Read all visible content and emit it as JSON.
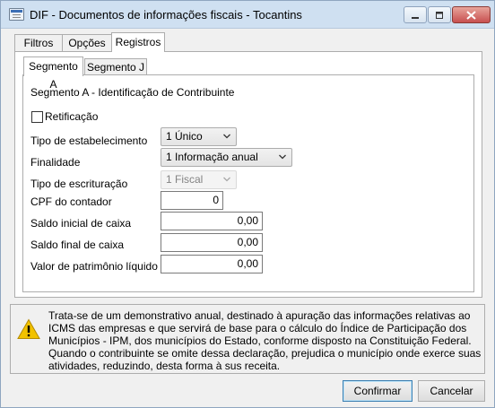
{
  "window": {
    "title": "DIF - Documentos de informações fiscais - Tocantins"
  },
  "tabs": [
    {
      "label": "Filtros",
      "active": false
    },
    {
      "label": "Opções",
      "active": false
    },
    {
      "label": "Registros",
      "active": true
    }
  ],
  "subtabs": [
    {
      "label": "Segmento A",
      "active": true
    },
    {
      "label": "Segmento J",
      "active": false
    }
  ],
  "form": {
    "section_title": "Segmento A - Identificação de Contribuinte",
    "retificacao_label": "Retificação",
    "retificacao_checked": false,
    "tipo_estabelecimento_label": "Tipo de estabelecimento",
    "tipo_estabelecimento_value": "1 Único",
    "finalidade_label": "Finalidade",
    "finalidade_value": "1 Informação anual",
    "tipo_escrituracao_label": "Tipo de escrituração",
    "tipo_escrituracao_value": "1 Fiscal",
    "cpf_contador_label": "CPF do contador",
    "cpf_contador_value": "0",
    "saldo_inicial_label": "Saldo inicial de caixa",
    "saldo_inicial_value": "0,00",
    "saldo_final_label": "Saldo final de caixa",
    "saldo_final_value": "0,00",
    "valor_patrimonio_label": "Valor de patrimônio líquido",
    "valor_patrimonio_value": "0,00"
  },
  "info": {
    "text": "Trata-se de um demonstrativo anual, destinado à apuração das informações relativas ao ICMS das empresas e que servirá de base para o cálculo do Índice de Participação dos Municípios - IPM, dos municípios do Estado, conforme disposto na Constituição Federal. Quando o contribuinte se omite dessa declaração, prejudica o município onde exerce suas atividades, reduzindo,  desta forma à sus receita."
  },
  "buttons": {
    "confirm_label": "Confirmar",
    "cancel_label": "Cancelar"
  },
  "colors": {
    "titlebar": "#cfe0f1",
    "close_button": "#c75050",
    "warning": "#f2c200"
  }
}
